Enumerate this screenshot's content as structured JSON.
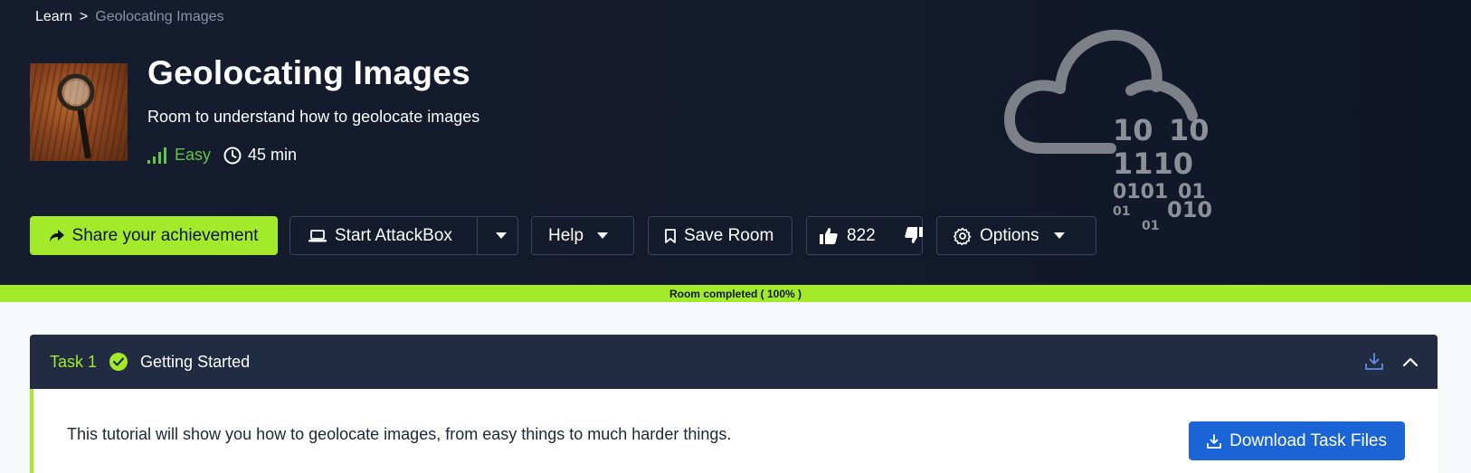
{
  "breadcrumb": {
    "root": "Learn",
    "separator": ">",
    "current": "Geolocating Images"
  },
  "room": {
    "title": "Geolocating Images",
    "subtitle": "Room to understand how to geolocate images",
    "difficulty": "Easy",
    "duration": "45 min",
    "thumbnail_icon": "magnifying-glass-image"
  },
  "actions": {
    "share_label": "Share your achievement",
    "attackbox_label": "Start AttackBox",
    "help_label": "Help",
    "save_label": "Save Room",
    "like_count": "822",
    "options_label": "Options"
  },
  "cloud_binary": {
    "row1a": "10",
    "row1b": "10",
    "row2": "1110",
    "row3a": "0101",
    "row3b": "01",
    "row4a": "01",
    "row4b": "010",
    "row5": "01"
  },
  "progress": {
    "label": "Room completed ( 100% )",
    "value": 1.0
  },
  "task": {
    "number": "Task 1",
    "title": "Getting Started",
    "body": "This tutorial will show you how to geolocate images, from easy things to much harder things.",
    "download_label": "Download Task Files"
  },
  "colors": {
    "accent": "#a3ea2a",
    "hero_bg": "#151c2e",
    "task_header": "#212c42",
    "download": "#1a64d6",
    "easy": "#5fc64a"
  }
}
